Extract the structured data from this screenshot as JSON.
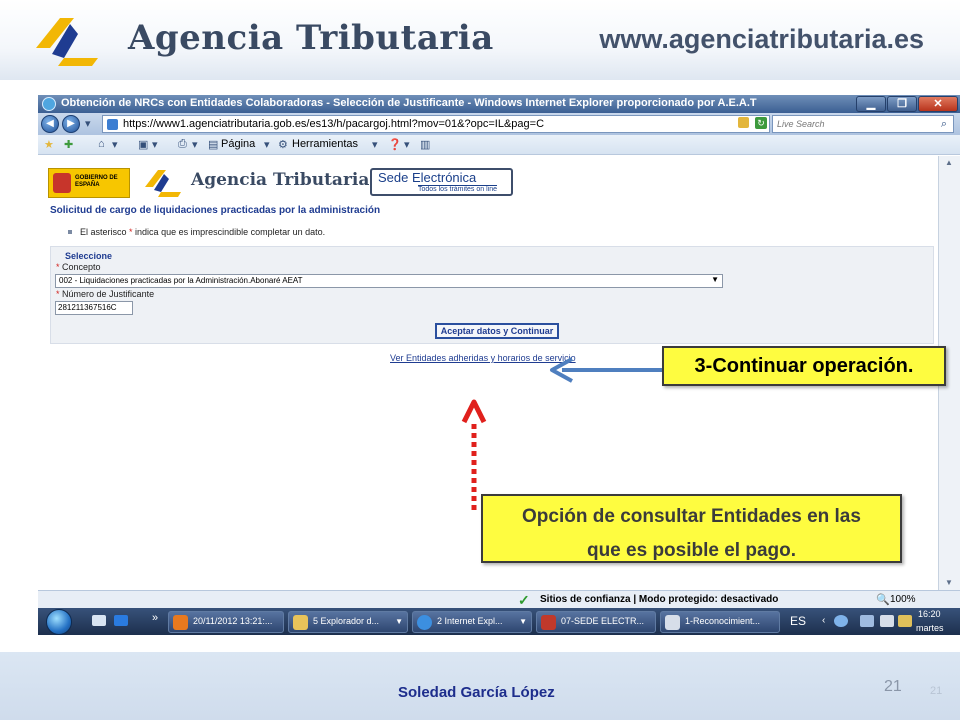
{
  "slide": {
    "header_title": "Agencia Tributaria",
    "header_url": "www.agenciatributaria.es",
    "author": "Soledad García López",
    "page_number": "21"
  },
  "browser": {
    "title": "Obtención de NRCs con Entidades Colaboradoras - Selección de Justificante - Windows Internet Explorer proporcionado por A.E.A.T",
    "url": "https://www1.agenciatributaria.gob.es/es13/h/pacargoj.html?mov=01&?opc=IL&pag=C",
    "search_placeholder": "Live Search",
    "commands": {
      "page": "Página",
      "tools": "Herramientas"
    },
    "window_buttons": {
      "minimize": "▁",
      "maximize": "❐",
      "close": "✕"
    }
  },
  "site": {
    "gov_badge": "GOBIERNO DE ESPAÑA",
    "name": "Agencia Tributaria",
    "sede_title": "Sede Electrónica",
    "sede_subtitle": "Todos los trámites on line"
  },
  "form": {
    "title": "Solicitud de cargo de liquidaciones practicadas por la administración",
    "note_before": "El asterisco ",
    "note_star": "*",
    "note_after": " indica que es imprescindible completar un dato.",
    "panel_heading": "Seleccione",
    "concepto_label": "Concepto",
    "concepto_value": "002 - Liquidaciones practicadas por la Administración.Abonaré AEAT",
    "justificante_label": "Número de Justificante",
    "justificante_value": "281211367516C",
    "submit_label": "Aceptar datos y Continuar",
    "entities_link": "Ver Entidades adheridas y horarios de servicio",
    "required_marker": "*"
  },
  "status_bar": {
    "security_text": "Sitios de confianza | Modo protegido: desactivado",
    "zoom": "100%"
  },
  "taskbar": {
    "more": "»",
    "items": [
      {
        "label": "20/11/2012 13:21:..."
      },
      {
        "label": "5 Explorador d..."
      },
      {
        "label": "2 Internet Expl..."
      },
      {
        "label": "07-SEDE ELECTR..."
      },
      {
        "label": "1-Reconocimient..."
      }
    ],
    "language": "ES",
    "time": "16:20",
    "day": "martes"
  },
  "callouts": {
    "continue": "3-Continuar operación.",
    "entities_line1": "Opción de consultar Entidades en las",
    "entities_line2": "que es posible el pago."
  },
  "colors": {
    "callout_fill": "#fefc40",
    "arrow_blue": "#4f7fbf",
    "arrow_red": "#e0201c",
    "link_blue": "#1f3c91"
  }
}
